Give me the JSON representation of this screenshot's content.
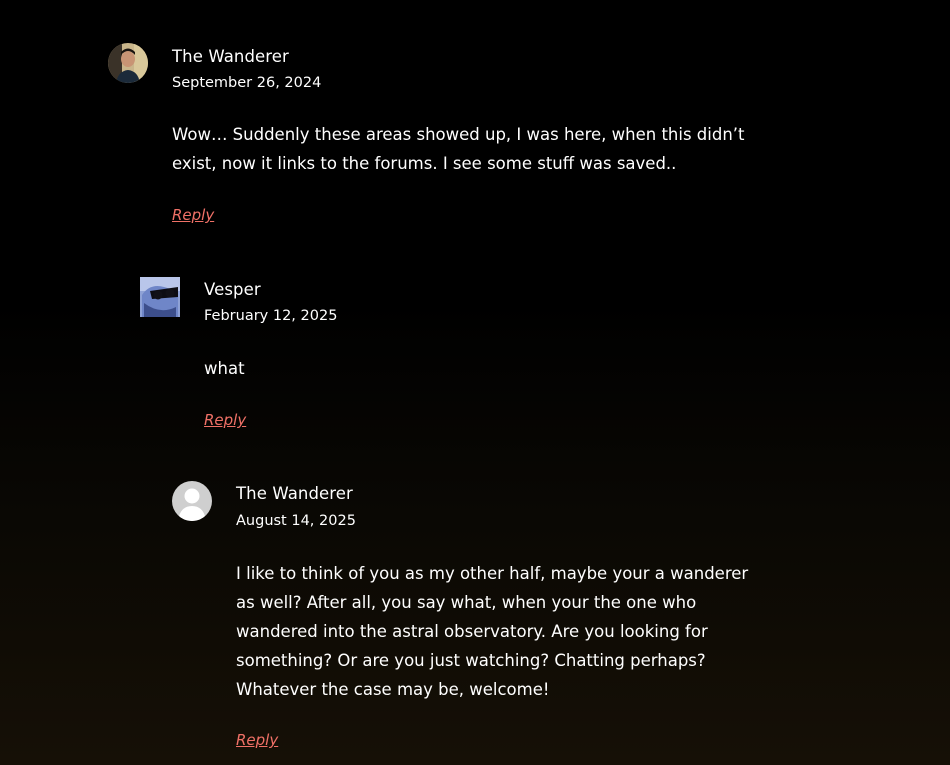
{
  "comments": [
    {
      "author": "The Wanderer",
      "date": "September 26, 2024",
      "lines": [
        "Wow… Suddenly these areas showed up, I was here, when this didn’t",
        "exist, now it links to the forums. I see some stuff was saved.."
      ],
      "reply_label": "Reply",
      "avatar": "photo-avatar"
    },
    {
      "author": "Vesper",
      "date": "February 12, 2025",
      "lines": [
        "what"
      ],
      "reply_label": "Reply",
      "avatar": "photo-avatar-sunglasses"
    },
    {
      "author": "The Wanderer",
      "date": "August 14, 2025",
      "lines": [
        "I like to think of you as my other half, maybe your a wanderer",
        "as well? After all, you say what, when your the one who",
        "wandered into the astral observatory. Are you looking for",
        "something? Or are you just watching? Chatting perhaps?",
        "Whatever the case may be, welcome!"
      ],
      "reply_label": "Reply",
      "avatar": "default-user-avatar"
    }
  ],
  "colors": {
    "background": "#000000",
    "text": "#ffffff",
    "reply_link": "#f07167"
  }
}
